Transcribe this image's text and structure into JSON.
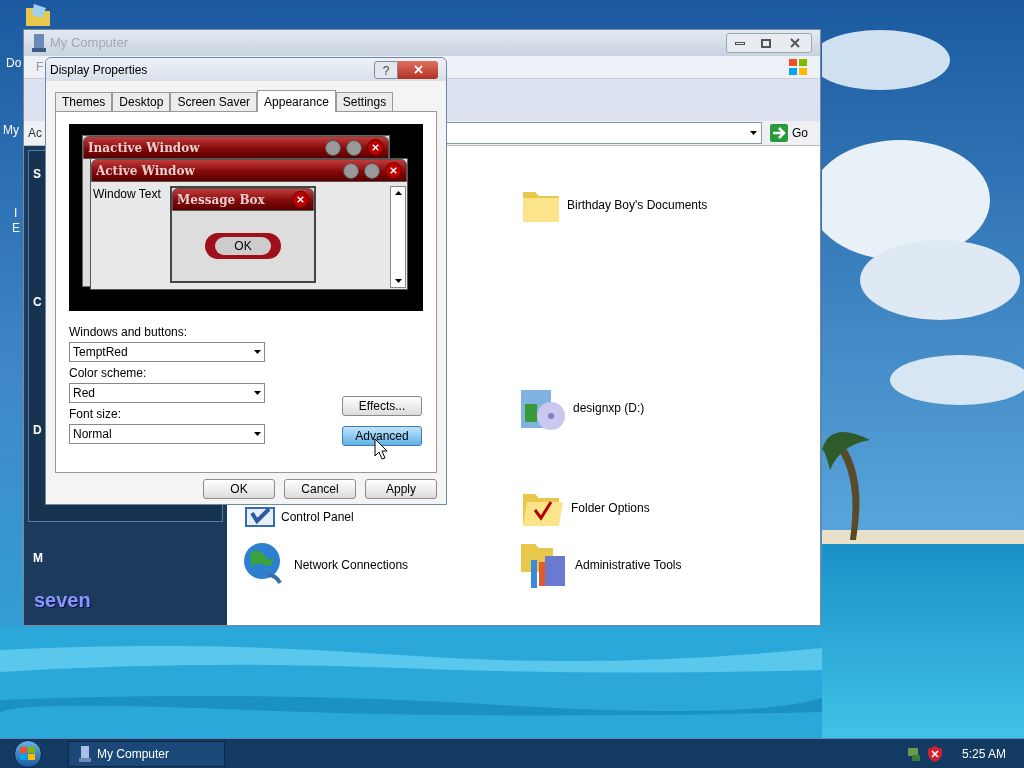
{
  "desktop": {
    "icons": [
      {
        "label": "Do"
      },
      {
        "label": "My"
      },
      {
        "label": "I"
      },
      {
        "label": "E"
      }
    ]
  },
  "explorer": {
    "title": "My Computer",
    "menu": [
      "F"
    ],
    "address_label": "Ac",
    "go": "Go",
    "side_panel": {
      "headings": [
        "S",
        "C",
        "D",
        "M"
      ],
      "logo": "seven"
    },
    "items": [
      {
        "label": "Birthday Boy's Documents",
        "kind": "folder"
      },
      {
        "label": "designxp (D:)",
        "kind": "disc"
      },
      {
        "label": "Control Panel",
        "kind": "control"
      },
      {
        "label": "Folder Options",
        "kind": "options"
      },
      {
        "label": "Network Connections",
        "kind": "network"
      },
      {
        "label": "Administrative Tools",
        "kind": "tools"
      }
    ]
  },
  "dialog": {
    "title": "Display Properties",
    "help": "?",
    "tabs": [
      {
        "label": "Themes",
        "selected": false
      },
      {
        "label": "Desktop",
        "selected": false
      },
      {
        "label": "Screen Saver",
        "selected": false
      },
      {
        "label": "Appearance",
        "selected": true
      },
      {
        "label": "Settings",
        "selected": false
      }
    ],
    "preview": {
      "inactive_title": "Inactive Window",
      "active_title": "Active Window",
      "window_text": "Window Text",
      "message_title": "Message Box",
      "message_button": "OK"
    },
    "fields": [
      {
        "label": "Windows and buttons:",
        "value": "TemptRed"
      },
      {
        "label": "Color scheme:",
        "value": "Red"
      },
      {
        "label": "Font size:",
        "value": "Normal"
      }
    ],
    "side_buttons": [
      {
        "label": "Effects...",
        "hovered": false
      },
      {
        "label": "Advanced",
        "hovered": true
      }
    ],
    "buttons": [
      "OK",
      "Cancel",
      "Apply"
    ]
  },
  "taskbar": {
    "tasks": [
      "My Computer"
    ],
    "clock": "5:25 AM"
  }
}
